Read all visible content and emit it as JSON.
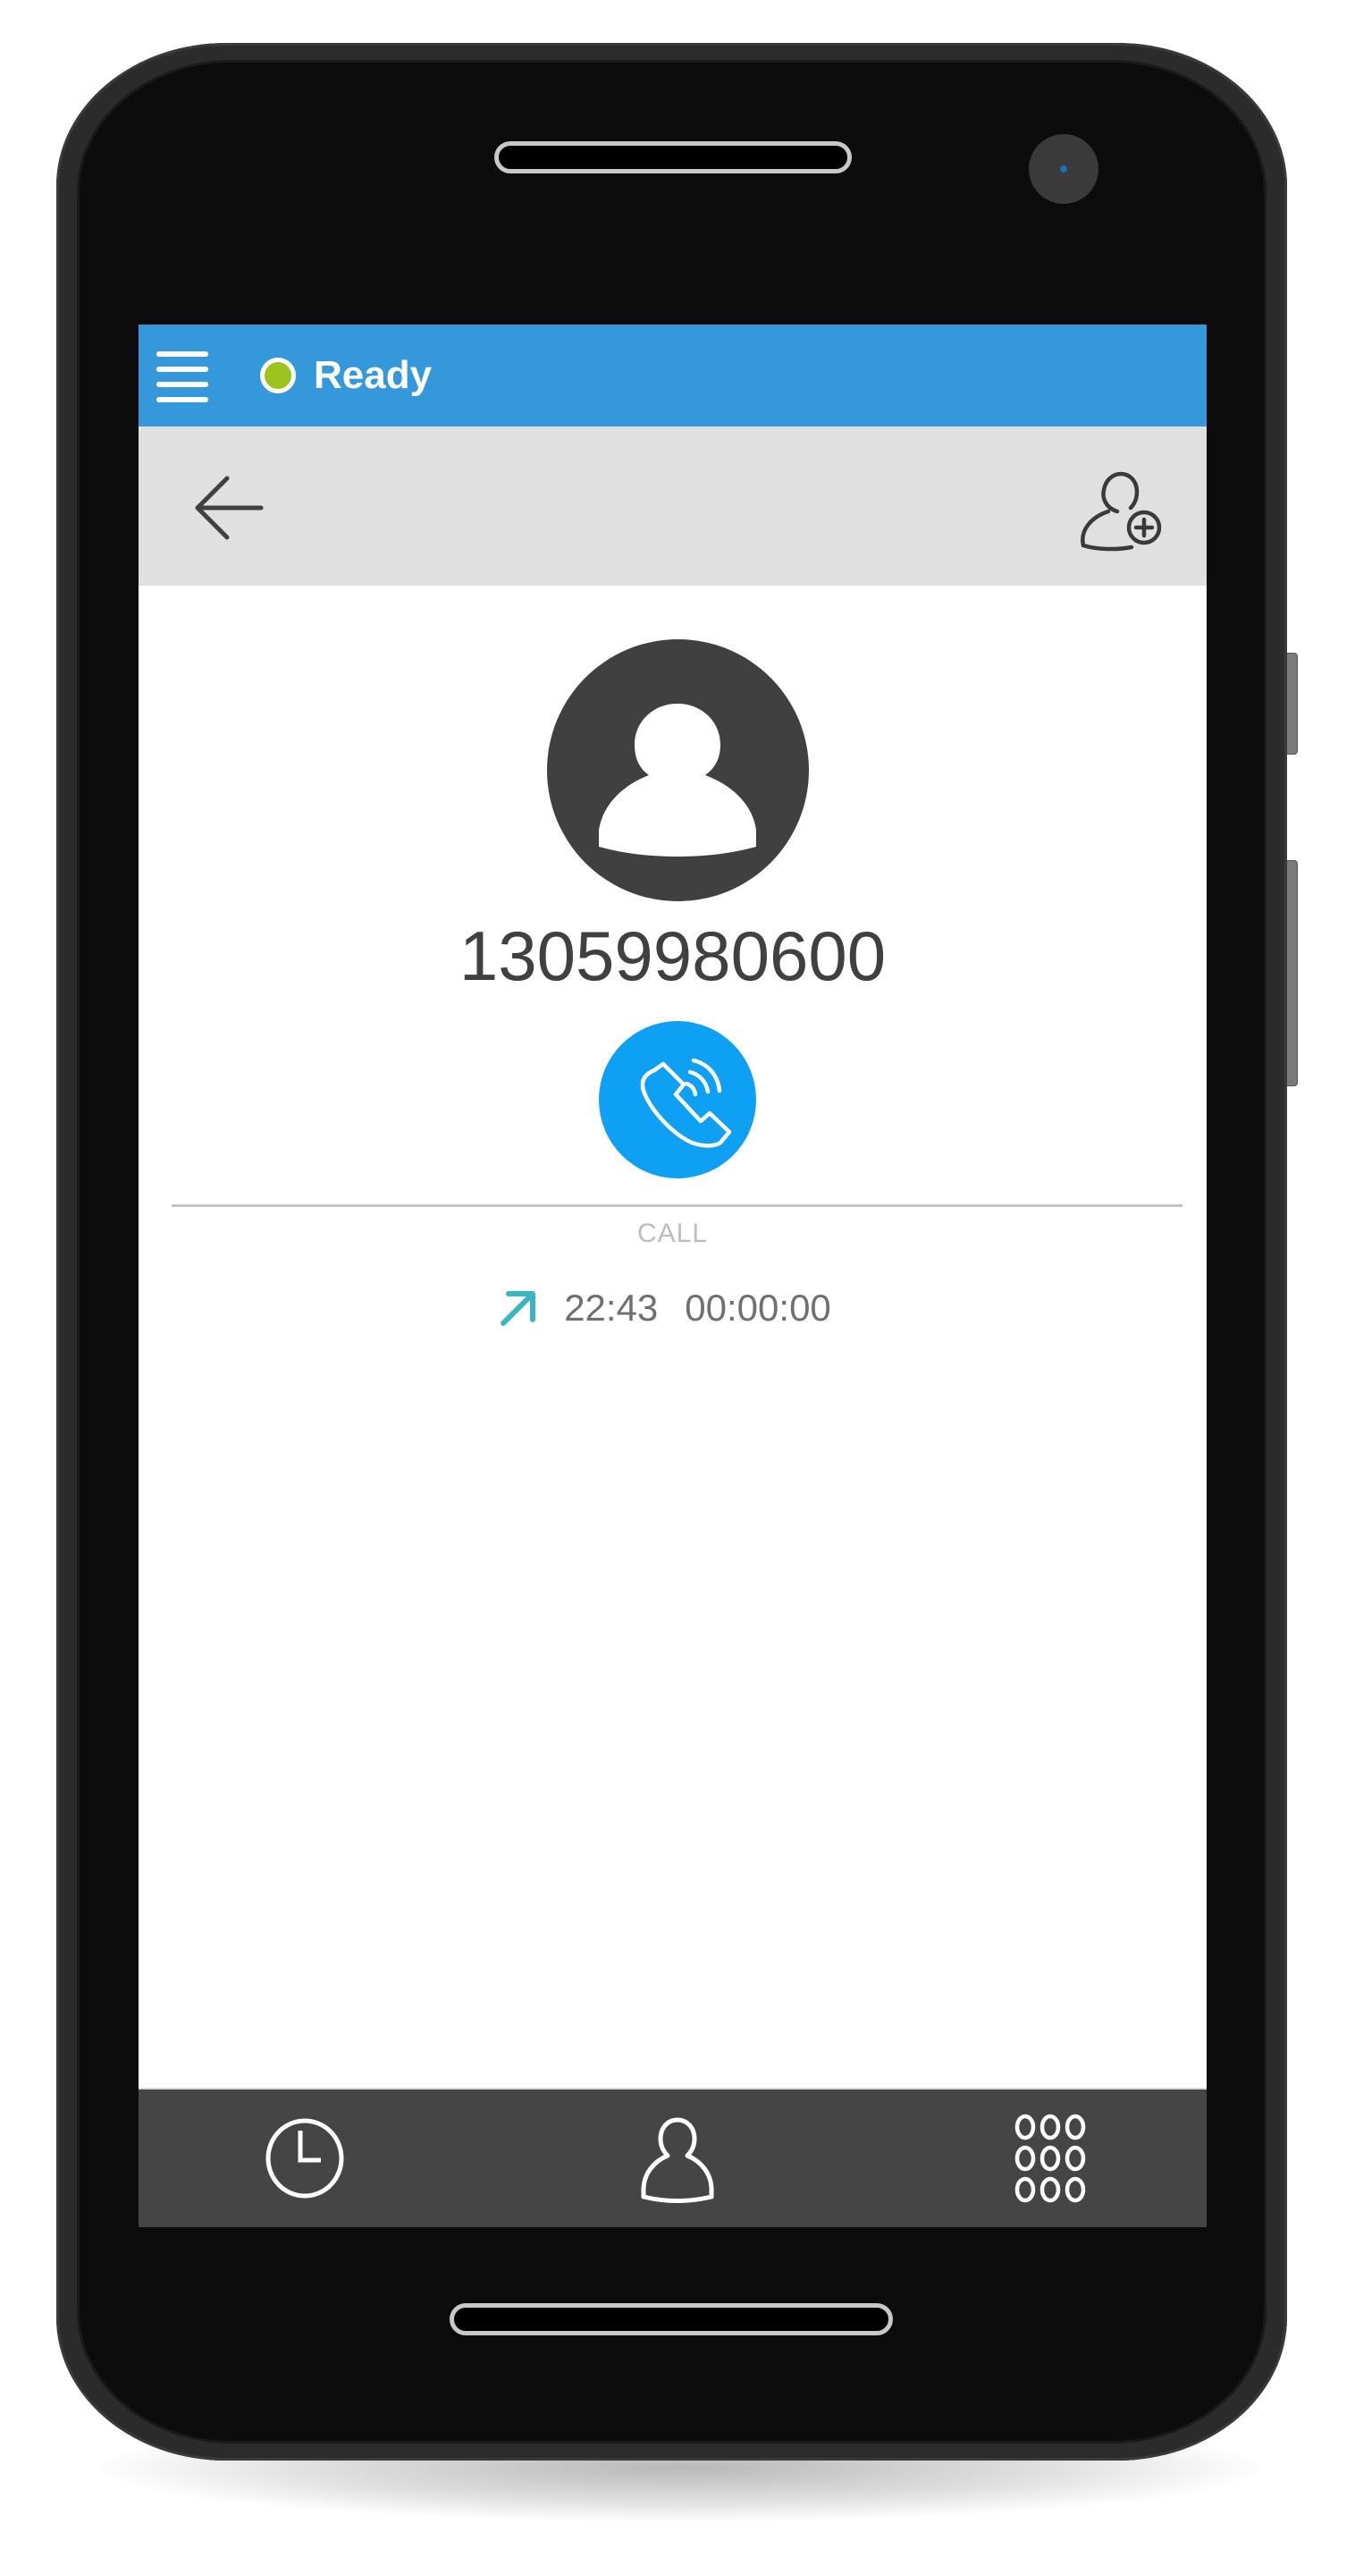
{
  "statusbar": {
    "menu_icon": "hamburger-menu-icon",
    "status_label": "Ready",
    "status_color": "#9dc31e",
    "bar_color": "#3498db"
  },
  "toolbar": {
    "back_icon": "arrow-left-icon",
    "add_contact_icon": "add-contact-icon"
  },
  "contact": {
    "avatar_icon": "person-silhouette-icon",
    "number": "13059980600",
    "call_button_icon": "phone-ringing-icon",
    "call_button_color": "#0ea0f2"
  },
  "history": {
    "section_label": "CALL",
    "entries": [
      {
        "direction": "outgoing",
        "direction_icon": "arrow-up-right-icon",
        "time": "22:43",
        "duration": "00:00:00",
        "icon_color": "#3bb5bf"
      }
    ]
  },
  "bottom_nav": {
    "items": [
      {
        "name": "recents",
        "icon": "clock-icon"
      },
      {
        "name": "contacts",
        "icon": "person-icon"
      },
      {
        "name": "dialpad",
        "icon": "dialpad-icon"
      }
    ]
  }
}
